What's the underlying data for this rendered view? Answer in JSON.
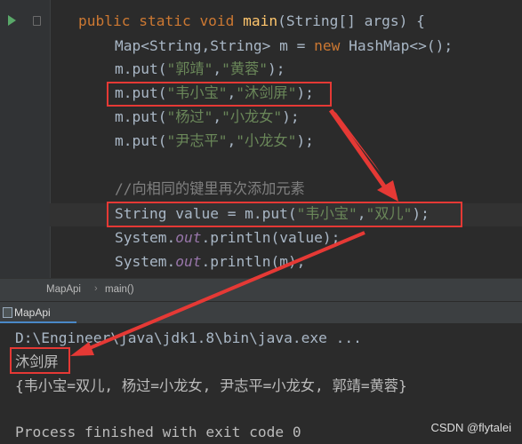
{
  "editor": {
    "lines": {
      "l1": {
        "kw": "public static void ",
        "fn": "main",
        "rest": "(String[] args) {"
      },
      "l2": {
        "pre": "Map<String,String> m = ",
        "kw": "new",
        "rest": " HashMap<>();"
      },
      "l3": {
        "pre": "m.put(",
        "s1": "\"郭靖\"",
        "mid": ",",
        "s2": "\"黄蓉\"",
        "end": ");"
      },
      "l4": {
        "pre": "m.put(",
        "s1": "\"韦小宝\"",
        "mid": ",",
        "s2": "\"沐剑屏\"",
        "end": ");"
      },
      "l5": {
        "pre": "m.put(",
        "s1": "\"杨过\"",
        "mid": ",",
        "s2": "\"小龙女\"",
        "end": ");"
      },
      "l6": {
        "pre": "m.put(",
        "s1": "\"尹志平\"",
        "mid": ",",
        "s2": "\"小龙女\"",
        "end": ");"
      },
      "l8": {
        "comment": "//向相同的键里再次添加元素"
      },
      "l9": {
        "pre": "String value = m.put(",
        "s1": "\"韦小宝\"",
        "mid": ",",
        "s2": "\"双儿\"",
        "end": ");"
      },
      "l10": {
        "pre": "System.",
        "fld": "out",
        "end": ".println(value);"
      },
      "l11": {
        "pre": "System.",
        "fld": "out",
        "end": ".println(m);"
      }
    }
  },
  "breadcrumb": {
    "class_name": "MapApi",
    "method_name": "main()"
  },
  "run_panel": {
    "tab_label": "MapApi"
  },
  "console": {
    "command": "D:\\Engineer\\java\\jdk1.8\\bin\\java.exe ...",
    "output_value": "沐剑屏",
    "output_map": "{韦小宝=双儿, 杨过=小龙女, 尹志平=小龙女, 郭靖=黄蓉}",
    "exit_message": "Process finished with exit code 0"
  },
  "watermark": "CSDN @flytalei",
  "colors": {
    "annotation_red": "#e53935",
    "keyword": "#cc7832",
    "string": "#6a8759",
    "comment": "#808080",
    "method": "#ffc66d",
    "field": "#9876aa"
  },
  "icons": {
    "run": "run-icon",
    "fold": "fold-icon",
    "tab": "console-tab-icon"
  }
}
